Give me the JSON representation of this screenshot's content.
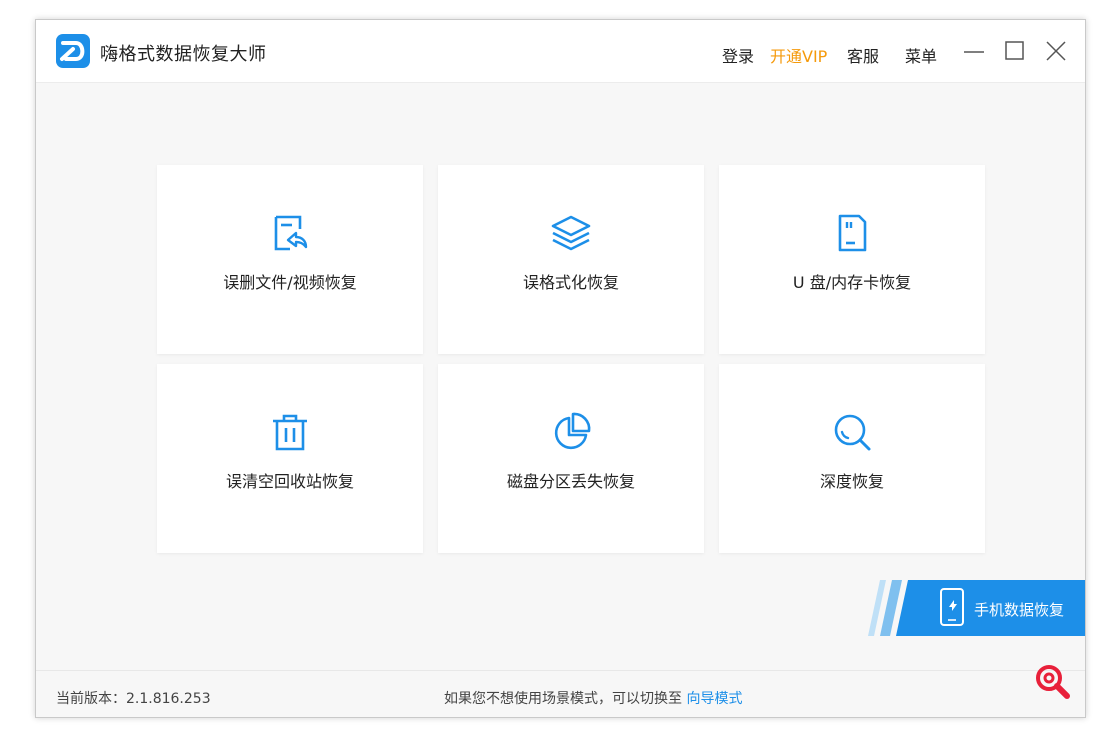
{
  "app": {
    "title": "嗨格式数据恢复大师"
  },
  "topnav": {
    "login": "登录",
    "vip": "开通VIP",
    "service": "客服",
    "menu": "菜单"
  },
  "cards": [
    {
      "label": "误删文件/视频恢复",
      "icon": "file-restore-icon"
    },
    {
      "label": "误格式化恢复",
      "icon": "layers-icon"
    },
    {
      "label": "U 盘/内存卡恢复",
      "icon": "sd-card-icon"
    },
    {
      "label": "误清空回收站恢复",
      "icon": "trash-icon"
    },
    {
      "label": "磁盘分区丢失恢复",
      "icon": "pie-chart-icon"
    },
    {
      "label": "深度恢复",
      "icon": "magnifier-icon"
    }
  ],
  "mobile": {
    "label": "手机数据恢复"
  },
  "footer": {
    "version": "当前版本：2.1.816.253",
    "hint": "如果您不想使用场景模式，可以切换至",
    "link": "向导模式"
  },
  "colors": {
    "accent": "#1d8fe8",
    "vip": "#f59a0c",
    "corner": "#e8203a"
  }
}
